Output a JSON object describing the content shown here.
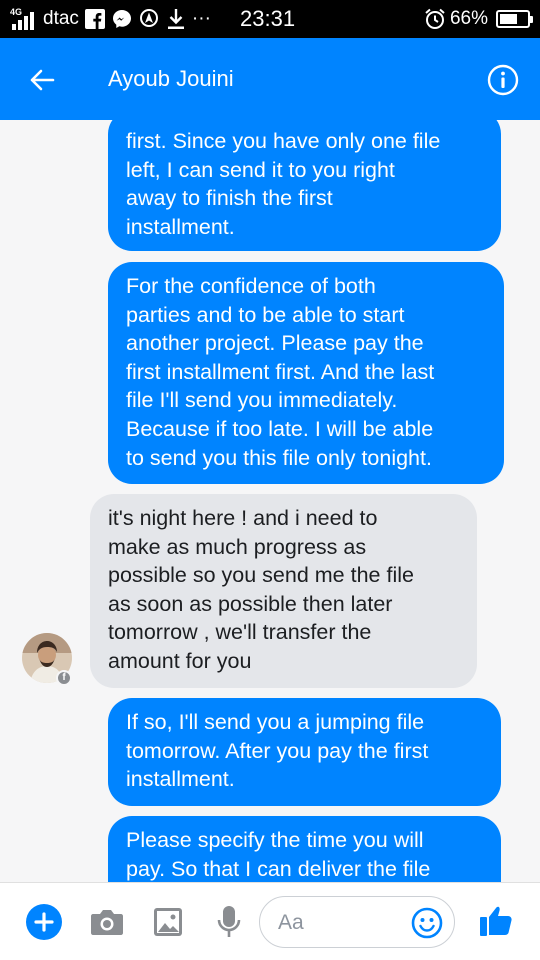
{
  "status_bar": {
    "network_type": "4G",
    "carrier": "dtac",
    "more": "···",
    "time": "23:31",
    "battery_percent": "66%",
    "battery_level": 0.66,
    "icons": [
      "signal-icon",
      "facebook-icon",
      "messenger-icon",
      "location-icon",
      "download-icon",
      "alarm-icon",
      "battery-icon"
    ]
  },
  "header": {
    "contact_name": "Ayoub Jouini",
    "back_icon": "back-arrow-icon",
    "info_icon": "info-icon"
  },
  "messages": [
    {
      "direction": "outgoing",
      "lines": [
        "first. Since you have only one file",
        "left, I can send it to you right",
        "away to finish the first",
        "installment."
      ]
    },
    {
      "direction": "outgoing",
      "lines": [
        "For the confidence of both",
        "parties and to be able to start",
        "another project. Please pay the",
        "first installment first. And the last",
        "file I'll send you immediately.",
        "Because if too late. I will be able",
        "to send you this file only tonight."
      ]
    },
    {
      "direction": "incoming",
      "lines": [
        "it's night here ! and i need to",
        "make as much progress as",
        "possible so you send me the file",
        "as soon as possible then later",
        "tomorrow , we'll transfer the",
        "amount for you"
      ]
    },
    {
      "direction": "outgoing",
      "lines": [
        "If so, I'll send you a jumping file",
        "tomorrow. After you pay the first",
        "installment."
      ]
    },
    {
      "direction": "outgoing",
      "lines": [
        "Please specify the time you will",
        "pay. So that I can deliver the file"
      ]
    }
  ],
  "composer": {
    "placeholder": "Aa",
    "icons": [
      "add-icon",
      "camera-icon",
      "image-icon",
      "microphone-icon",
      "emoji-icon",
      "thumbs-up-icon"
    ]
  },
  "colors": {
    "accent": "#0084ff",
    "incoming_bubble": "#e4e6ea",
    "background": "#f6f6f7",
    "status_bar": "#000000"
  }
}
